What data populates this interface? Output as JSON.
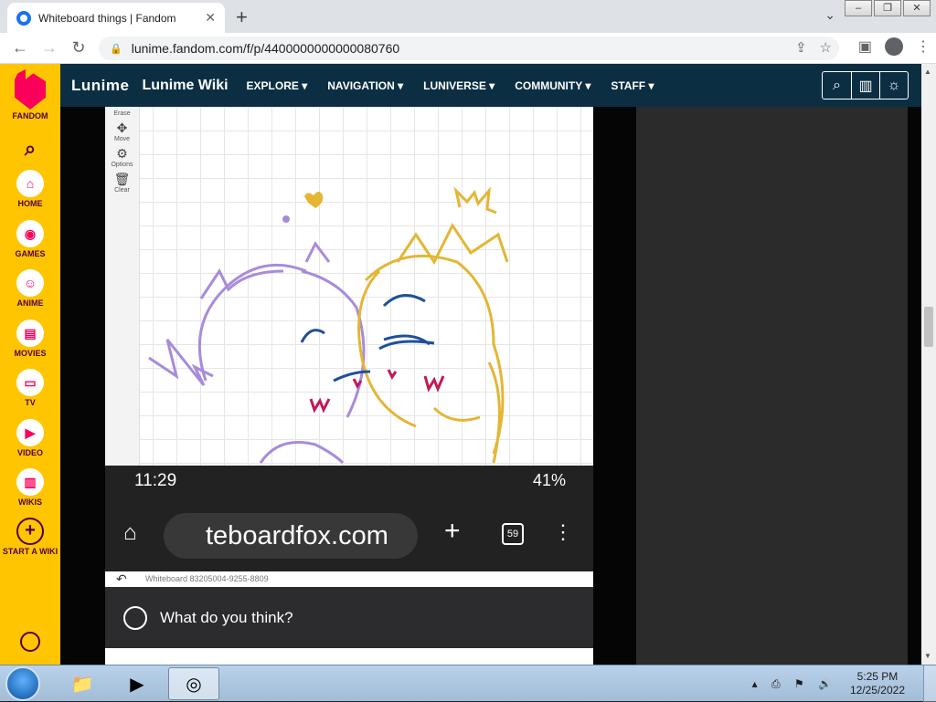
{
  "browser": {
    "tab_title": "Whiteboard things | Fandom",
    "tab_close": "✕",
    "new_tab": "+",
    "url": "lunime.fandom.com/f/p/4400000000000080760"
  },
  "fandom_rail": {
    "brand": "FANDOM",
    "items": [
      {
        "label": "HOME"
      },
      {
        "label": "GAMES"
      },
      {
        "label": "ANIME"
      },
      {
        "label": "MOVIES"
      },
      {
        "label": "TV"
      },
      {
        "label": "VIDEO"
      },
      {
        "label": "WIKIS"
      },
      {
        "label": "START A WIKI"
      }
    ]
  },
  "wiki_header": {
    "logo": "Lunime",
    "name": "Lunime Wiki",
    "nav": [
      "EXPLORE ▾",
      "NAVIGATION ▾",
      "LUNIVERSE ▾",
      "COMMUNITY ▾",
      "STAFF ▾"
    ]
  },
  "drawing_tools": [
    {
      "label": "Erase"
    },
    {
      "label": "Move"
    },
    {
      "label": "Options"
    },
    {
      "label": "Clear"
    }
  ],
  "phone": {
    "time": "11:29",
    "battery": "41%",
    "url_text": "teboardfox.com",
    "tab_count": "59"
  },
  "whiteboard_label": "Whiteboard 83205004-9255-8809",
  "comment_placeholder": "What do you think?",
  "taskbar": {
    "time": "5:25 PM",
    "date": "12/25/2022"
  },
  "colors": {
    "fandom_yellow": "#ffc500",
    "wiki_header": "#0b2e43",
    "purple_sketch": "#a78bdb",
    "gold_sketch": "#e4b634",
    "blue_sketch": "#1f4f9b",
    "pink_sketch": "#c3185a"
  }
}
